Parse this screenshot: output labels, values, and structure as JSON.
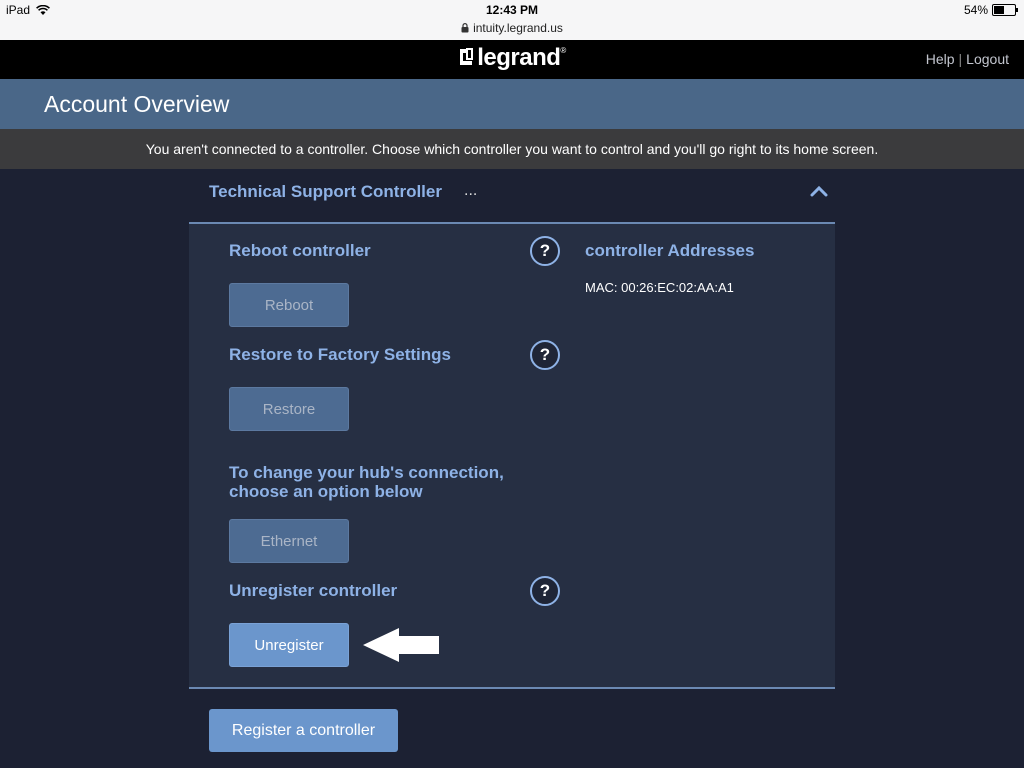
{
  "status_bar": {
    "device": "iPad",
    "time": "12:43 PM",
    "url": "intuity.legrand.us",
    "battery_percent": "54%",
    "battery_level": 0.54
  },
  "header": {
    "logo_text": "legrand",
    "links": [
      "Help",
      "Logout"
    ]
  },
  "page": {
    "title": "Account Overview",
    "notice": "You aren't connected to a controller. Choose which controller you want to control and you'll go right to its home screen."
  },
  "controller": {
    "name": "Technical Support Controller",
    "ellipsis": "...",
    "addresses_title": "controller Addresses",
    "mac": "MAC: 00:26:EC:02:AA:A1",
    "sections": {
      "reboot": {
        "title": "Reboot controller",
        "button": "Reboot"
      },
      "restore": {
        "title": "Restore to Factory Settings",
        "button": "Restore"
      },
      "connection": {
        "title_line1": "To change your hub's connection,",
        "title_line2": "choose an option below",
        "button": "Ethernet"
      },
      "unregister": {
        "title": "Unregister controller",
        "button": "Unregister"
      }
    },
    "help_glyph": "?"
  },
  "footer": {
    "register_button": "Register a controller"
  },
  "colors": {
    "background": "#1c2133",
    "title_band": "#4a6788",
    "accent_text": "#8eb2e6",
    "button_active": "#6b96cc",
    "button_inactive": "#4d6b92"
  }
}
